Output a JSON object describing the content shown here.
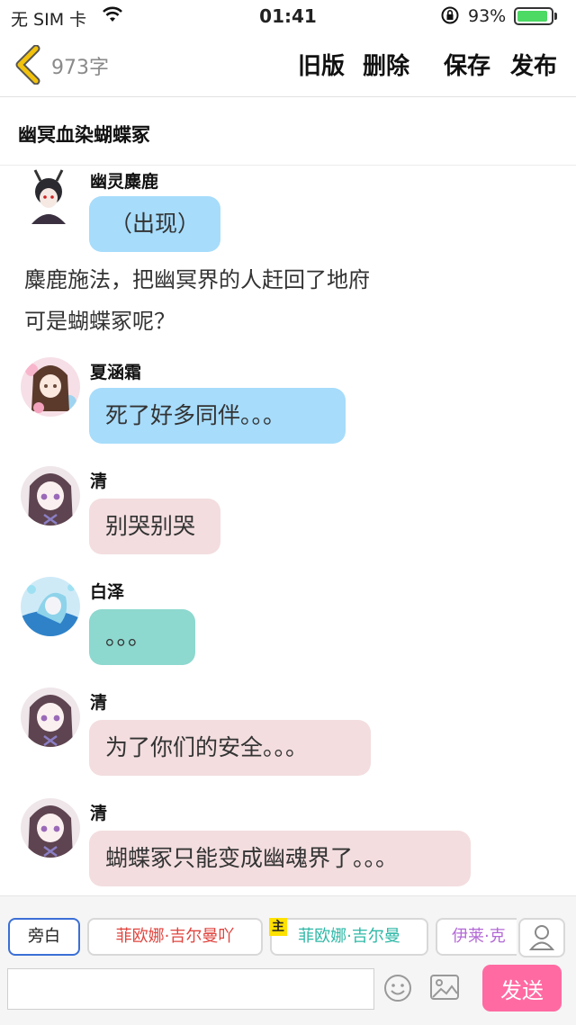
{
  "status_bar": {
    "carrier": "无 SIM 卡",
    "time": "01:41",
    "battery": "93%",
    "battery_level": 0.93
  },
  "nav": {
    "char_count": "973字",
    "actions": [
      "旧版",
      "删除",
      "保存",
      "发布"
    ]
  },
  "story_title": "幽冥血染蝴蝶冢",
  "messages": [
    {
      "type": "dialog",
      "name": "幽灵麋鹿",
      "text": "（出现）",
      "bubble_color": "#a7dcfb"
    },
    {
      "type": "narration",
      "lines": [
        "麋鹿施法，把幽冥界的人赶回了地府",
        "可是蝴蝶冢呢？"
      ]
    },
    {
      "type": "dialog",
      "name": "夏涵霜",
      "text": "死了好多同伴。。。",
      "bubble_color": "#a7dcfb"
    },
    {
      "type": "dialog",
      "name": "清",
      "text": "别哭别哭",
      "bubble_color": "#f3dddf"
    },
    {
      "type": "dialog",
      "name": "白泽",
      "text": "。。。",
      "bubble_color": "#8dd8cf"
    },
    {
      "type": "dialog",
      "name": "清",
      "text": "为了你们的安全。。。",
      "bubble_color": "#f3dddf"
    },
    {
      "type": "dialog",
      "name": "清",
      "text": "蝴蝶冢只能变成幽魂界了。。。",
      "bubble_color": "#f3dddf"
    }
  ],
  "bottom_bar": {
    "roles": [
      {
        "label": "旁白",
        "color": "#222222",
        "selected": true
      },
      {
        "label": "菲欧娜·吉尔曼吖",
        "color": "#e0453f",
        "selected": false
      },
      {
        "label": "菲欧娜·吉尔曼",
        "color": "#2fb8a7",
        "selected": false,
        "badge": "主"
      },
      {
        "label": "伊莱·克",
        "color": "#b36ad6",
        "selected": false
      }
    ],
    "input_value": "",
    "send_label": "发送",
    "contact_icon": "person-icon",
    "emoji_icon": "smiley-icon",
    "image_icon": "picture-icon"
  },
  "colors": {
    "accent_pink": "#ff6aa2",
    "back_arrow": "#f2c20c"
  }
}
